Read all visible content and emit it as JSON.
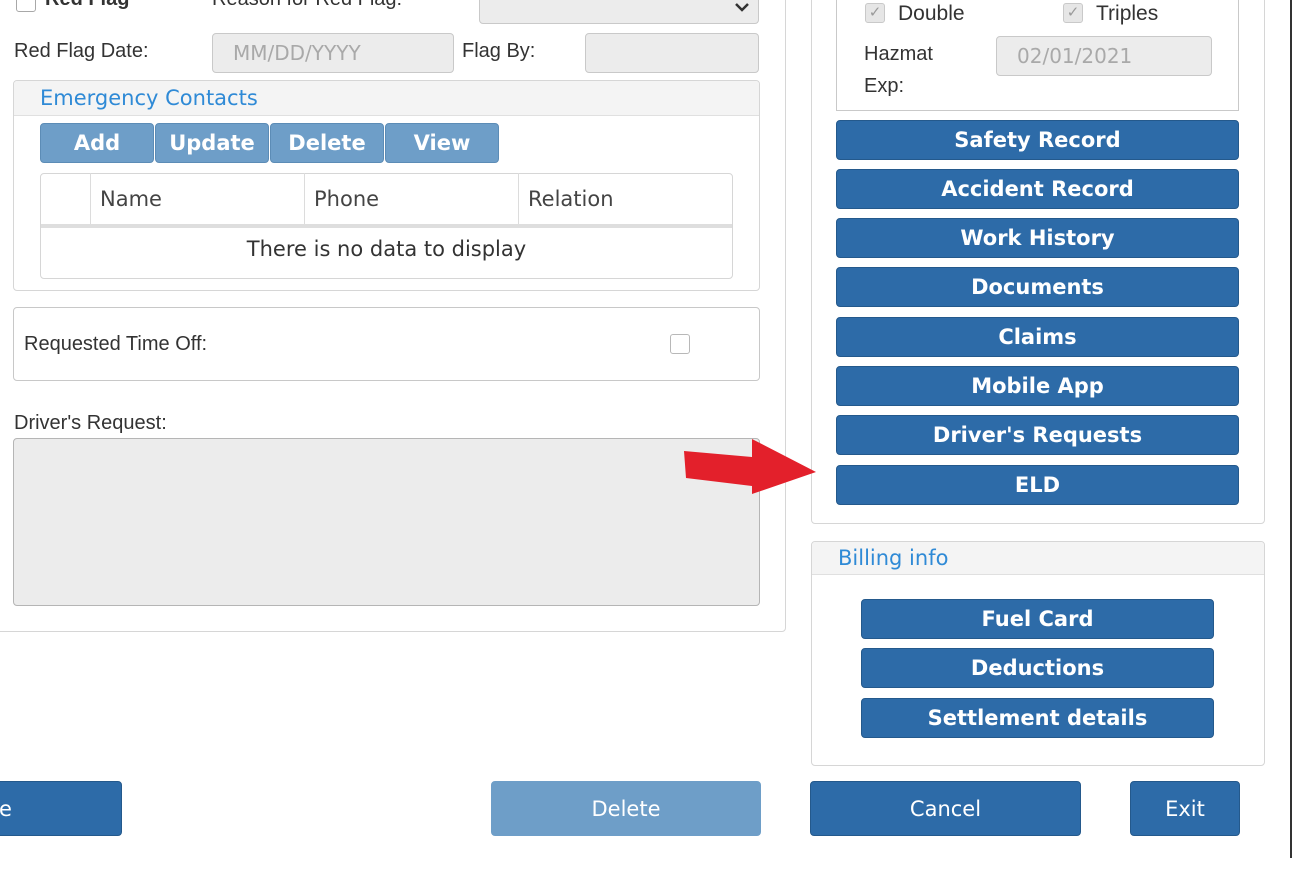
{
  "flags": {
    "red_flag_label": "Red Flag",
    "reason_label": "Reason for Red Flag:",
    "red_flag_date_label": "Red Flag Date:",
    "red_flag_date_placeholder": "MM/DD/YYYY",
    "flag_by_label": "Flag By:"
  },
  "emergency_contacts": {
    "title": "Emergency Contacts",
    "buttons": {
      "add": "Add",
      "update": "Update",
      "delete": "Delete",
      "view": "View"
    },
    "columns": [
      "Name",
      "Phone",
      "Relation"
    ],
    "empty_message": "There is no data to display"
  },
  "time_off": {
    "label": "Requested Time Off:",
    "checked": false
  },
  "drivers_request": {
    "label": "Driver's Request:",
    "value": ""
  },
  "endorsements": {
    "double_label": "Double",
    "double_checked": true,
    "triples_label": "Triples",
    "triples_checked": true,
    "hazmat_label_line1": "Hazmat",
    "hazmat_label_line2": "Exp:",
    "hazmat_exp_value": "02/01/2021"
  },
  "record_buttons": [
    "Safety Record",
    "Accident Record",
    "Work History",
    "Documents",
    "Claims",
    "Mobile App",
    "Driver's Requests",
    "ELD"
  ],
  "billing": {
    "title": "Billing info",
    "buttons": [
      "Fuel Card",
      "Deductions",
      "Settlement details"
    ]
  },
  "footer": {
    "save_partial": "e",
    "delete": "Delete",
    "cancel": "Cancel",
    "exit": "Exit"
  },
  "colors": {
    "primary": "#2d6ba8",
    "primary_light": "#6e9ec8",
    "link": "#2f8ad6",
    "arrow": "#e3202b"
  }
}
